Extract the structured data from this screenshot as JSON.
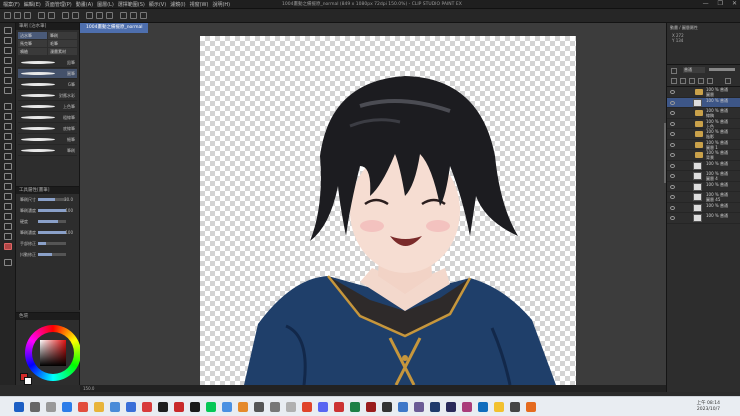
{
  "window": {
    "menu_items": [
      "檔案(F)",
      "編輯(E)",
      "頁面管理(P)",
      "動畫(A)",
      "圖層(L)",
      "選擇範圍(S)",
      "顯示(V)",
      "濾鏡(I)",
      "視窗(W)",
      "說明(H)"
    ],
    "title": "1004畫動之備援原_normal (849 x 1080px 72dpi 150.0%) - CLIP STUDIO PAINT EX",
    "controls": [
      "—",
      "❐",
      "✕"
    ]
  },
  "subtool_panel": {
    "header": "筆刷 [沾水筆]",
    "groups": [
      "沾水筆",
      "筆刷",
      "馬克筆",
      "毛筆",
      "噴槍",
      "漫畫素材"
    ],
    "brushes": [
      "鉛筆",
      "圓筆",
      "G筆",
      "對應水彩",
      "上色筆",
      "粗線筆",
      "底線筆",
      "細筆",
      "筆刷"
    ]
  },
  "tool_property": {
    "header": "工具屬性[畫筆]",
    "rows": [
      {
        "label": "筆刷尺寸",
        "value": "30.0",
        "level": 0.6
      },
      {
        "label": "筆刷濃度",
        "value": "100",
        "level": 1.0
      },
      {
        "label": "硬度",
        "value": "",
        "level": 0.7
      },
      {
        "label": "筆刷濃度",
        "value": "100",
        "level": 1.0
      },
      {
        "label": "手部修正",
        "value": "",
        "level": 0.3
      },
      {
        "label": "抖動修正",
        "value": "",
        "level": 0.5
      }
    ]
  },
  "color_panel": {
    "header": "色環"
  },
  "canvas": {
    "doc_tab": "1004畫動之備援原_normal",
    "zoom": "150.0"
  },
  "navigator": {
    "title": "動畫 / 圖層屬性",
    "coords": [
      "X 272",
      "Y 134"
    ]
  },
  "layers": {
    "blend_mode": "普通",
    "items": [
      {
        "name": "100 % 普通",
        "sub": "圖層",
        "kind": "folder",
        "selected": false
      },
      {
        "name": "100 % 普通",
        "sub": "",
        "kind": "thumb",
        "selected": true
      },
      {
        "name": "100 % 普通",
        "sub": "線稿",
        "kind": "folder",
        "selected": false
      },
      {
        "name": "100 % 普通",
        "sub": "上色",
        "kind": "folder",
        "selected": false
      },
      {
        "name": "100 % 普通",
        "sub": "陰影",
        "kind": "folder",
        "selected": false
      },
      {
        "name": "100 % 普通",
        "sub": "圖層 1",
        "kind": "folder",
        "selected": false
      },
      {
        "name": "100 % 普通",
        "sub": "背景",
        "kind": "folder",
        "selected": false
      },
      {
        "name": "100 % 普通",
        "sub": "",
        "kind": "thumb",
        "selected": false
      },
      {
        "name": "100 % 普通",
        "sub": "圖層 4",
        "kind": "thumb",
        "selected": false
      },
      {
        "name": "100 % 普通",
        "sub": "",
        "kind": "thumb",
        "selected": false
      },
      {
        "name": "100 % 普通",
        "sub": "圖層 45",
        "kind": "thumb",
        "selected": false
      },
      {
        "name": "100 % 普通",
        "sub": "",
        "kind": "thumb",
        "selected": false
      },
      {
        "name": "100 % 普通",
        "sub": "",
        "kind": "thumb",
        "selected": false
      }
    ]
  },
  "taskbar": {
    "time": "上午 08:14",
    "date": "2023/10/7"
  }
}
